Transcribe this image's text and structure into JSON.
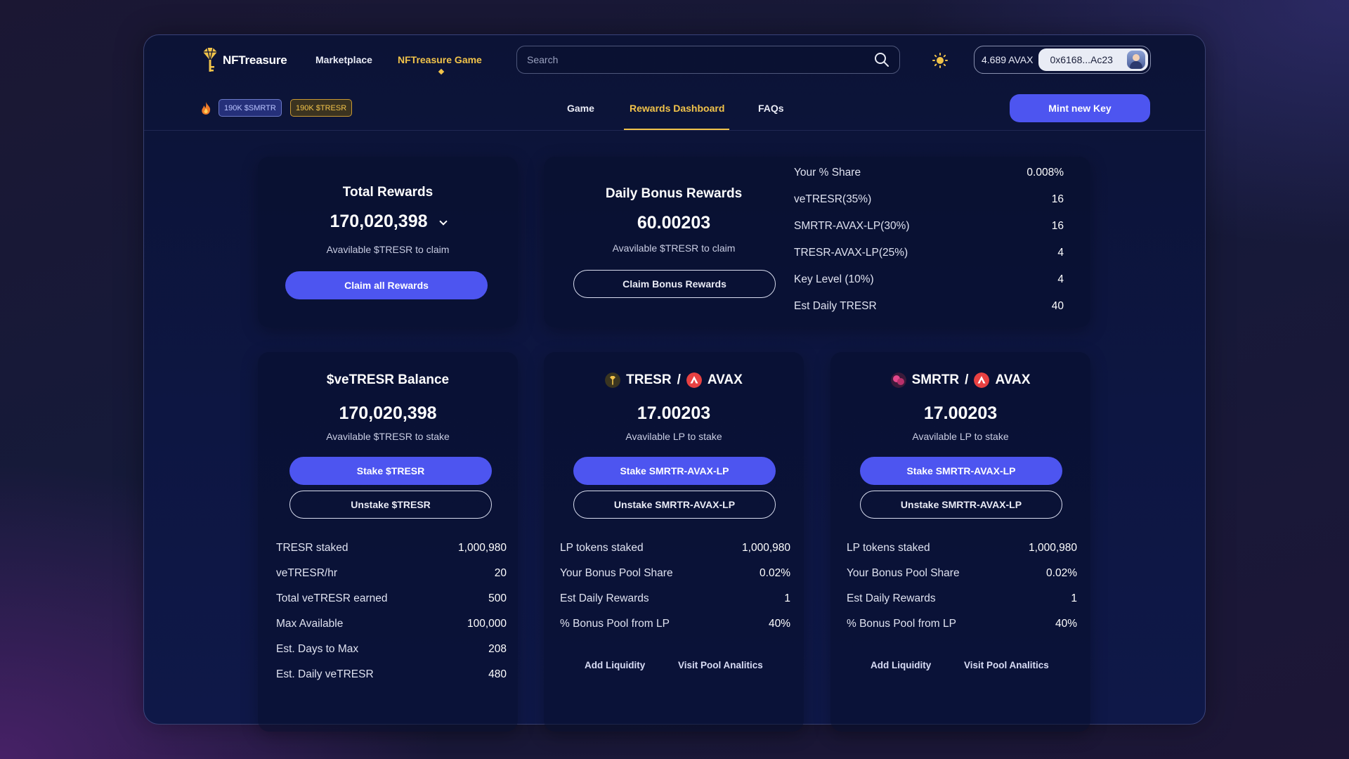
{
  "brand": {
    "name": "NFTreasure"
  },
  "nav": {
    "marketplace": "Marketplace",
    "game": "NFTreasure Game"
  },
  "search": {
    "placeholder": "Search"
  },
  "wallet": {
    "balance": "4.689 AVAX",
    "address": "0x6168...Ac23"
  },
  "badges": {
    "smrtr": "190K $SMRTR",
    "tresr": "190K $TRESR"
  },
  "subnav": {
    "game": "Game",
    "rewards": "Rewards Dashboard",
    "faqs": "FAQs"
  },
  "mint_label": "Mint new Key",
  "total_rewards": {
    "title": "Total Rewards",
    "value": "170,020,398",
    "subtitle": "Avavilable $TRESR to claim",
    "button": "Claim all Rewards"
  },
  "daily_bonus": {
    "title": "Daily Bonus Rewards",
    "value": "60.00203",
    "subtitle": "Avavilable $TRESR to claim",
    "button": "Claim Bonus Rewards",
    "stats": [
      {
        "label": "Your % Share",
        "value": "0.008%"
      },
      {
        "label": "veTRESR(35%)",
        "value": "16"
      },
      {
        "label": "SMRTR-AVAX-LP(30%)",
        "value": "16"
      },
      {
        "label": "TRESR-AVAX-LP(25%)",
        "value": "4"
      },
      {
        "label": "Key Level (10%)",
        "value": "4"
      },
      {
        "label": "Est Daily TRESR",
        "value": "40"
      }
    ]
  },
  "vetresr": {
    "title": "$veTRESR Balance",
    "value": "170,020,398",
    "subtitle": "Avavilable $TRESR to stake",
    "stake": "Stake $TRESR",
    "unstake": "Unstake $TRESR",
    "stats": [
      {
        "label": "TRESR staked",
        "value": "1,000,980"
      },
      {
        "label": "veTRESR/hr",
        "value": "20"
      },
      {
        "label": "Total veTRESR earned",
        "value": "500"
      },
      {
        "label": "Max Available",
        "value": "100,000"
      },
      {
        "label": "Est. Days to Max",
        "value": "208"
      },
      {
        "label": "Est. Daily veTRESR",
        "value": "480"
      }
    ]
  },
  "pool_tresr": {
    "token_a": "TRESR",
    "sep": "/",
    "token_b": "AVAX",
    "value": "17.00203",
    "subtitle": "Avavilable LP to stake",
    "stake": "Stake SMRTR-AVAX-LP",
    "unstake": "Unstake SMRTR-AVAX-LP",
    "stats": [
      {
        "label": "LP tokens staked",
        "value": "1,000,980"
      },
      {
        "label": "Your Bonus Pool Share",
        "value": "0.02%"
      },
      {
        "label": "Est Daily Rewards",
        "value": "1"
      },
      {
        "label": "% Bonus Pool from LP",
        "value": "40%"
      }
    ],
    "add_liquidity": "Add Liquidity",
    "analytics": "Visit Pool Analitics"
  },
  "pool_smrtr": {
    "token_a": "SMRTR",
    "sep": "/",
    "token_b": "AVAX",
    "value": "17.00203",
    "subtitle": "Avavilable LP to stake",
    "stake": "Stake SMRTR-AVAX-LP",
    "unstake": "Unstake SMRTR-AVAX-LP",
    "stats": [
      {
        "label": "LP tokens staked",
        "value": "1,000,980"
      },
      {
        "label": "Your Bonus Pool Share",
        "value": "0.02%"
      },
      {
        "label": "Est Daily Rewards",
        "value": "1"
      },
      {
        "label": "% Bonus Pool from LP",
        "value": "40%"
      }
    ],
    "add_liquidity": "Add Liquidity",
    "analytics": "Visit Pool Analitics"
  },
  "colors": {
    "accent": "#4d55f0",
    "gold": "#f1c34a",
    "avax": "#e84142"
  }
}
